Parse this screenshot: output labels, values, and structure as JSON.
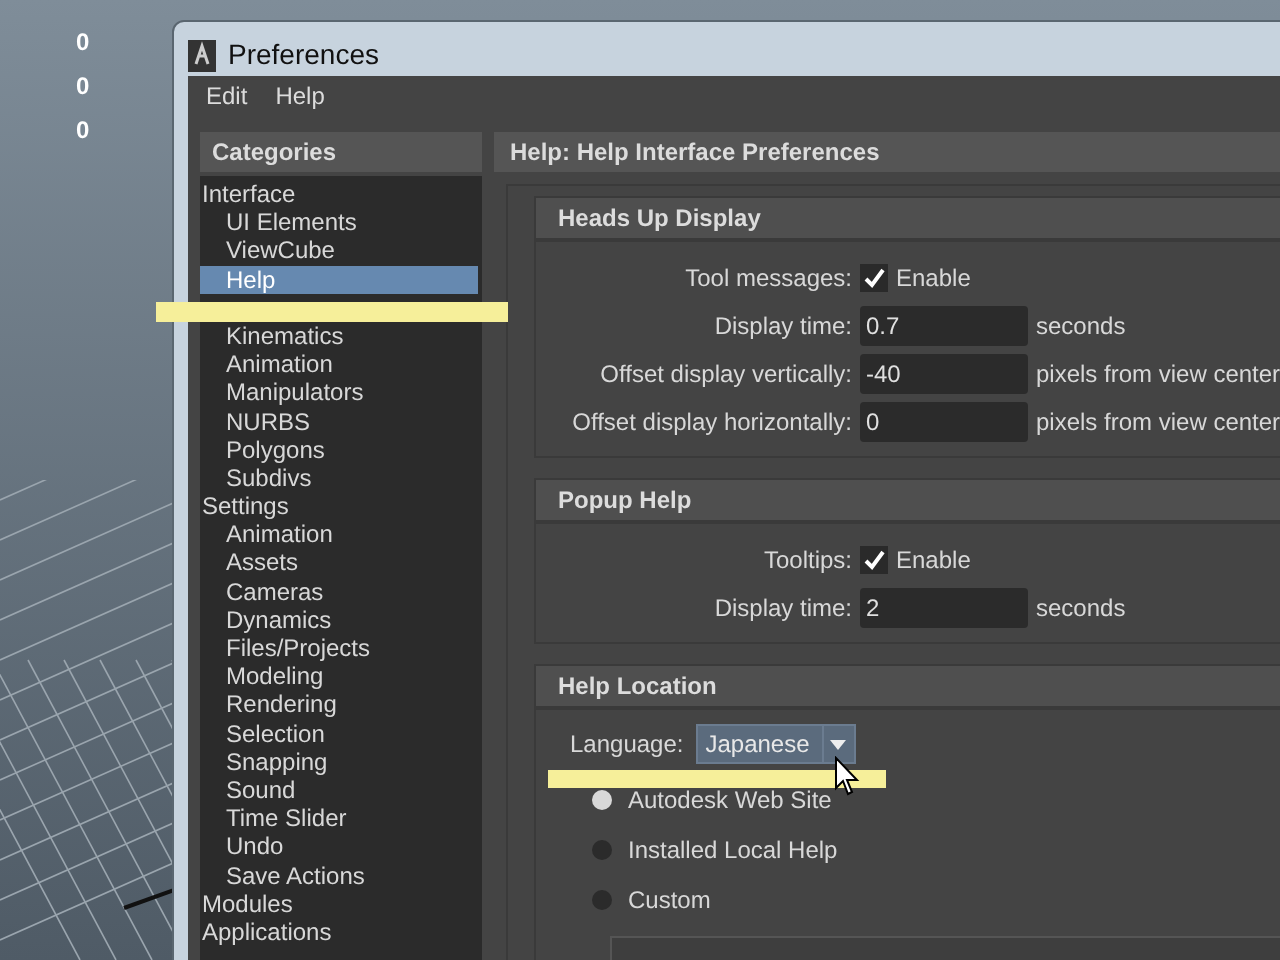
{
  "desktop": {
    "labels": [
      "0",
      "0",
      "0"
    ]
  },
  "window": {
    "title": "Preferences"
  },
  "menu": [
    "Edit",
    "Help"
  ],
  "categories": {
    "title": "Categories",
    "groups": [
      {
        "label": "Interface",
        "selected": false,
        "children": [
          {
            "label": "UI Elements",
            "selected": false
          },
          {
            "label": "ViewCube",
            "selected": false
          },
          {
            "label": "Help",
            "selected": true
          }
        ]
      },
      {
        "children": [
          {
            "label": "Kinematics",
            "selected": false
          },
          {
            "label": "Animation",
            "selected": false
          },
          {
            "label": "Manipulators",
            "selected": false
          },
          {
            "label": "NURBS",
            "selected": false
          },
          {
            "label": "Polygons",
            "selected": false
          },
          {
            "label": "Subdivs",
            "selected": false
          }
        ]
      },
      {
        "label": "Settings",
        "selected": false,
        "children": [
          {
            "label": "Animation",
            "selected": false
          },
          {
            "label": "Assets",
            "selected": false
          },
          {
            "label": "Cameras",
            "selected": false
          },
          {
            "label": "Dynamics",
            "selected": false
          },
          {
            "label": "Files/Projects",
            "selected": false
          },
          {
            "label": "Modeling",
            "selected": false
          },
          {
            "label": "Rendering",
            "selected": false
          },
          {
            "label": "Selection",
            "selected": false
          },
          {
            "label": "Snapping",
            "selected": false
          },
          {
            "label": "Sound",
            "selected": false
          },
          {
            "label": "Time Slider",
            "selected": false
          },
          {
            "label": "Undo",
            "selected": false
          },
          {
            "label": "Save Actions",
            "selected": false
          }
        ]
      },
      {
        "label": "Modules",
        "selected": false
      },
      {
        "label": "Applications",
        "selected": false
      }
    ]
  },
  "panel": {
    "title": "Help: Help Interface Preferences",
    "sections": [
      {
        "title": "Heads Up Display",
        "rows": [
          {
            "kind": "checkbox",
            "label": "Tool messages:",
            "checked": true,
            "text": "Enable"
          },
          {
            "kind": "field",
            "label": "Display time:",
            "value": "0.7",
            "unit": "seconds"
          },
          {
            "kind": "field",
            "label": "Offset display vertically:",
            "value": "-40",
            "unit": "pixels from view center"
          },
          {
            "kind": "field",
            "label": "Offset display horizontally:",
            "value": "0",
            "unit": "pixels from view center"
          }
        ]
      },
      {
        "title": "Popup Help",
        "rows": [
          {
            "kind": "checkbox",
            "label": "Tooltips:",
            "checked": true,
            "text": "Enable"
          },
          {
            "kind": "field",
            "label": "Display time:",
            "value": "2",
            "unit": "seconds"
          }
        ]
      },
      {
        "title": "Help Location",
        "language": {
          "label": "Language:",
          "value": "Japanese"
        },
        "options": [
          {
            "label": "Autodesk Web Site",
            "selected": true
          },
          {
            "label": "Installed Local Help",
            "selected": false
          },
          {
            "label": "Custom",
            "selected": false
          }
        ]
      }
    ]
  }
}
